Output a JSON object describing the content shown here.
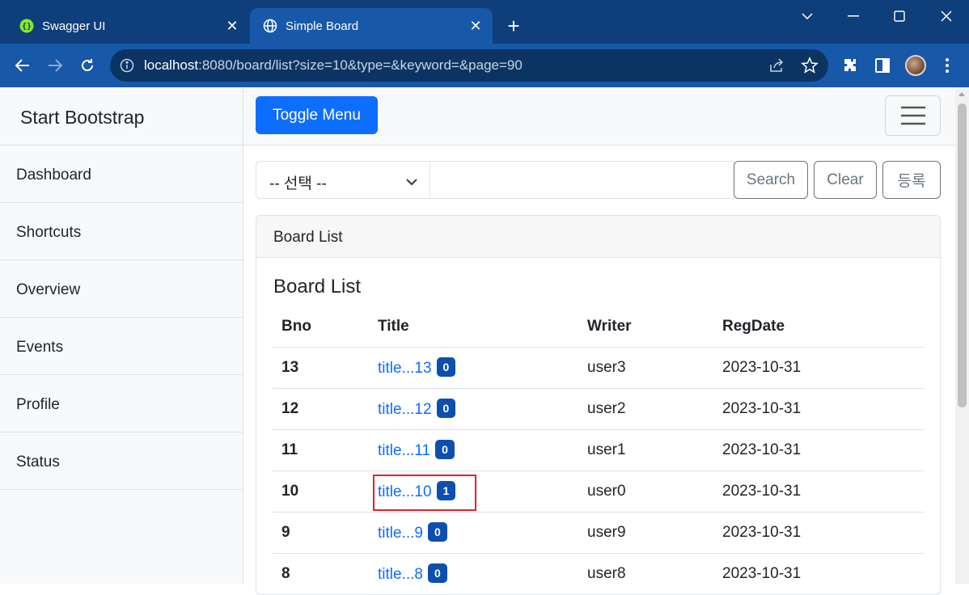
{
  "browser": {
    "tabs": [
      {
        "title": "Swagger UI",
        "icon": "swagger-icon",
        "active": false
      },
      {
        "title": "Simple Board",
        "icon": "globe-icon",
        "active": true
      }
    ],
    "url_host": "localhost",
    "url_rest": ":8080/board/list?size=10&type=&keyword=&page=90",
    "colors": {
      "tabstrip": "#0f3f7a",
      "toolbar": "#1858a8",
      "omnibox": "#0c3463"
    }
  },
  "sidebar": {
    "brand": "Start Bootstrap",
    "items": [
      {
        "label": "Dashboard"
      },
      {
        "label": "Shortcuts"
      },
      {
        "label": "Overview"
      },
      {
        "label": "Events"
      },
      {
        "label": "Profile"
      },
      {
        "label": "Status"
      }
    ]
  },
  "topnav": {
    "toggle_label": "Toggle Menu"
  },
  "search": {
    "select_value": "-- 선택 --",
    "keyword_value": "",
    "search_label": "Search",
    "clear_label": "Clear",
    "register_label": "등록"
  },
  "board": {
    "header": "Board List",
    "title": "Board List",
    "columns": [
      "Bno",
      "Title",
      "Writer",
      "RegDate"
    ],
    "rows": [
      {
        "bno": "13",
        "title": "title...13",
        "replies": "0",
        "writer": "user3",
        "regdate": "2023-10-31"
      },
      {
        "bno": "12",
        "title": "title...12",
        "replies": "0",
        "writer": "user2",
        "regdate": "2023-10-31"
      },
      {
        "bno": "11",
        "title": "title...11",
        "replies": "0",
        "writer": "user1",
        "regdate": "2023-10-31"
      },
      {
        "bno": "10",
        "title": "title...10",
        "replies": "1",
        "writer": "user0",
        "regdate": "2023-10-31"
      },
      {
        "bno": "9",
        "title": "title...9",
        "replies": "0",
        "writer": "user9",
        "regdate": "2023-10-31"
      },
      {
        "bno": "8",
        "title": "title...8",
        "replies": "0",
        "writer": "user8",
        "regdate": "2023-10-31"
      }
    ]
  },
  "colors": {
    "primary": "#0d6efd",
    "badge": "#0d4fb0",
    "highlight": "#d9252b"
  }
}
